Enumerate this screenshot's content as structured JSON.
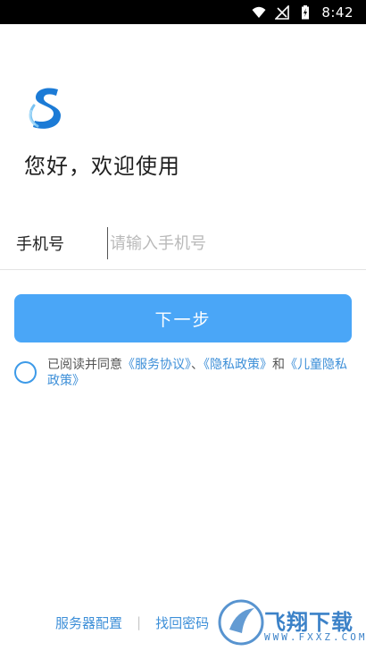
{
  "status_bar": {
    "time": "8:42",
    "icons": [
      "wifi-icon",
      "signal-icon",
      "battery-charging-icon"
    ]
  },
  "logo": {
    "icon": "brand-s-logo"
  },
  "welcome_text": "您好，欢迎使用",
  "phone": {
    "label": "手机号",
    "placeholder": "请输入手机号",
    "value": ""
  },
  "next_button": {
    "label": "下一步"
  },
  "agreement": {
    "checked": false,
    "prefix": "已阅读并同意",
    "service_link": "《服务协议》",
    "sep1": "、",
    "privacy_link": "《隐私政策》",
    "and": "和",
    "child_privacy_link": "《儿童隐私政策》"
  },
  "bottom_links": {
    "server_config": "服务器配置",
    "separator": "|",
    "recover_password": "找回密码"
  },
  "watermark": {
    "title": "飞翔下载",
    "url": "WWW.FXXZ.COM"
  },
  "colors": {
    "accent": "#4aa6f7",
    "link": "#3d8fd8",
    "status_bar": "#000000"
  }
}
